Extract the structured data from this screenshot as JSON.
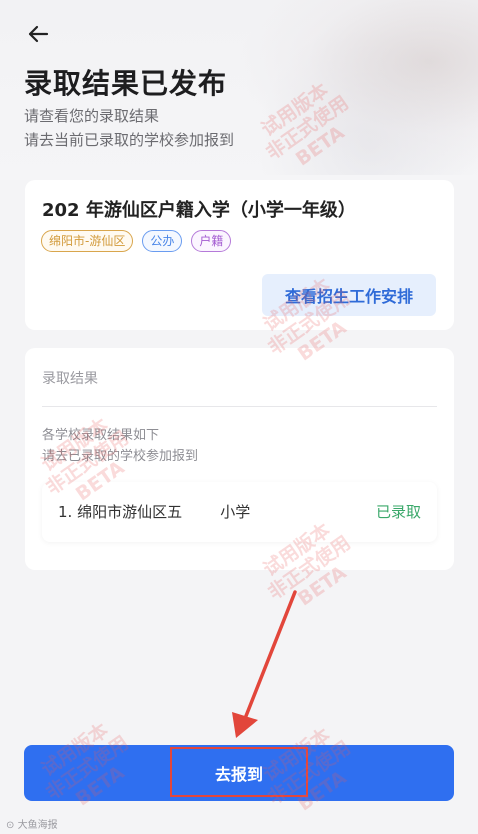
{
  "header": {
    "title": "录取结果已发布",
    "subtitle_line1": "请查看您的录取结果",
    "subtitle_line2": "请去当前已录取的学校参加报到"
  },
  "enrollment_card": {
    "title": "202  年游仙区户籍入学（小学一年级）",
    "tags": [
      "绵阳市-游仙区",
      "公办",
      "户籍"
    ],
    "arrangement_button": "查看招生工作安排"
  },
  "result_card": {
    "label": "录取结果",
    "desc_line1": "各学校录取结果如下",
    "desc_line2": "请去已录取的学校参加报到",
    "schools": [
      {
        "name": "1. 绵阳市游仙区五        小学",
        "status": "已录取"
      }
    ]
  },
  "actions": {
    "submit_label": "去报到"
  },
  "watermark": {
    "line1": "试用版本",
    "line2": "非正式使用",
    "line3": "BETA"
  },
  "footer": {
    "logo_text": "大鱼海报"
  },
  "colors": {
    "primary": "#2f6ff0",
    "status_green": "#3aa86a",
    "annotation_red": "#e2463b"
  }
}
